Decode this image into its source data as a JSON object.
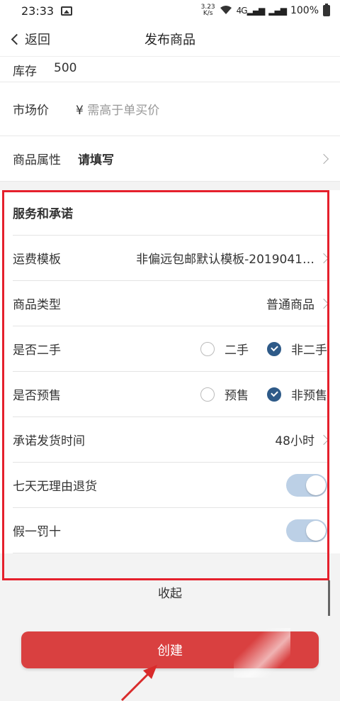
{
  "status_bar": {
    "time": "23:33",
    "speed_top": "3.23",
    "speed_bottom": "K/s",
    "signal": "4G",
    "battery": "100%"
  },
  "nav": {
    "back_label": "返回",
    "title": "发布商品"
  },
  "form_top": {
    "stock": {
      "label": "库存",
      "value": "500"
    },
    "market_price": {
      "label": "市场价",
      "currency": "¥",
      "placeholder": "需高于单买价"
    },
    "attributes": {
      "label": "商品属性",
      "value": "请填写"
    }
  },
  "service": {
    "heading": "服务和承诺",
    "shipping_template": {
      "label": "运费模板",
      "value": "非偏远包邮默认模板-2019041…"
    },
    "product_type": {
      "label": "商品类型",
      "value": "普通商品"
    },
    "second_hand": {
      "label": "是否二手",
      "options": [
        "二手",
        "非二手"
      ],
      "selected": "非二手"
    },
    "presale": {
      "label": "是否预售",
      "options": [
        "预售",
        "非预售"
      ],
      "selected": "非预售"
    },
    "ship_time": {
      "label": "承诺发货时间",
      "value": "48小时"
    },
    "seven_day_return": {
      "label": "七天无理由退货",
      "enabled": true
    },
    "fake_penalty": {
      "label": "假一罚十",
      "enabled": true
    }
  },
  "collapse_label": "收起",
  "create_button": "创建",
  "colors": {
    "accent_red": "#d94040",
    "highlight_border": "#e5202c",
    "radio_selected": "#2e5a88",
    "toggle_on": "#bcd0e6"
  }
}
